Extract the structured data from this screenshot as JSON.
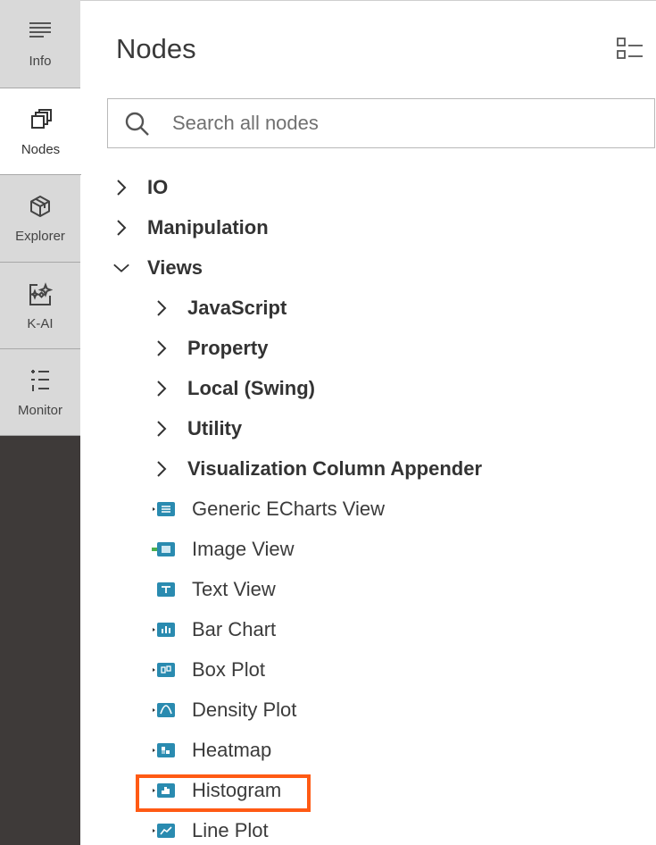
{
  "sidebar": {
    "items": [
      {
        "label": "Info",
        "icon": "info-lines-icon"
      },
      {
        "label": "Nodes",
        "icon": "nodes-stack-icon"
      },
      {
        "label": "Explorer",
        "icon": "cube-icon"
      },
      {
        "label": "K-AI",
        "icon": "ai-sparkle-icon"
      },
      {
        "label": "Monitor",
        "icon": "monitor-list-icon"
      }
    ]
  },
  "panel": {
    "title": "Nodes",
    "search_placeholder": "Search all nodes"
  },
  "tree": {
    "categories_top": [
      "IO",
      "Manipulation",
      "Views"
    ],
    "views_subcategories": [
      "JavaScript",
      "Property",
      "Local (Swing)",
      "Utility",
      "Visualization Column Appender"
    ],
    "views_nodes": [
      "Generic ECharts View",
      "Image View",
      "Text View",
      "Bar Chart",
      "Box Plot",
      "Density Plot",
      "Heatmap",
      "Histogram",
      "Line Plot"
    ]
  },
  "highlighted_node": "Histogram",
  "colors": {
    "sidebar_bg": "#3e3a39",
    "sidebar_item_bg": "#d9d9d9",
    "node_icon": "#2a8bb0",
    "highlight": "#ff5a14"
  }
}
